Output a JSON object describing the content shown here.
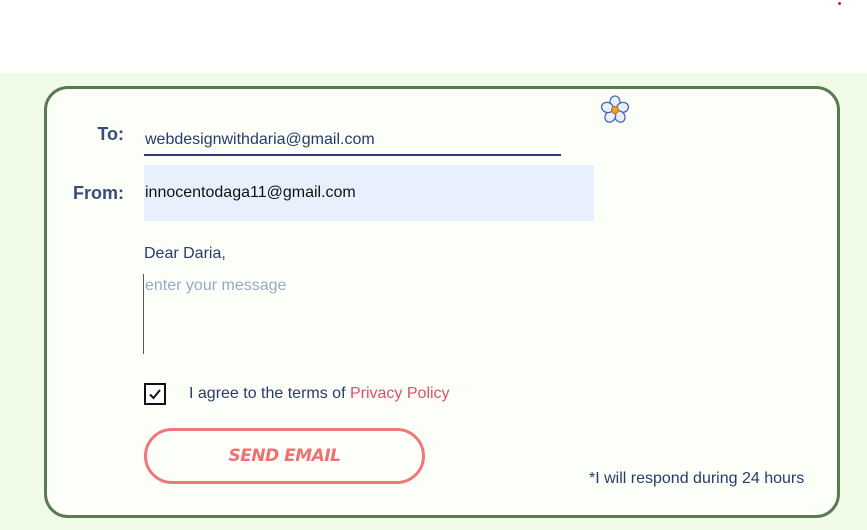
{
  "form": {
    "to_label": "To:",
    "to_value": "webdesignwithdaria@gmail.com",
    "from_label": "From:",
    "from_value": "innocentodaga11@gmail.com",
    "greeting": "Dear Daria,",
    "message_value": "",
    "message_placeholder": "enter your message",
    "agree_checked": true,
    "agree_text": "I agree to the terms of ",
    "privacy_link": "Privacy Policy",
    "send_button": "SEND EMAIL",
    "respond_note": "*I will respond during 24 hours"
  },
  "icons": {
    "decoration": "flower-icon",
    "checkbox": "check-mark-icon"
  },
  "colors": {
    "page_background": "#f0fce8",
    "card_border": "#5a7a52",
    "text": "#2a3a6b",
    "accent": "#f07070",
    "link": "#e0506a",
    "autofill_background": "#e8f0fe"
  }
}
